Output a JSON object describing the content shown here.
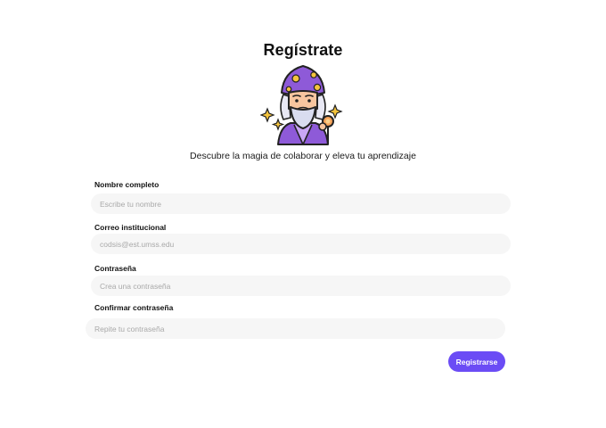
{
  "header": {
    "title": "Regístrate",
    "subtitle": "Descubre la magia de colaborar y eleva tu aprendizaje"
  },
  "mascot": {
    "icon": "wizard-icon"
  },
  "form": {
    "fields": [
      {
        "label": "Nombre completo",
        "placeholder": "Escribe tu nombre",
        "value": ""
      },
      {
        "label": "Correo institucional",
        "placeholder": "codsis@est.umss.edu",
        "value": ""
      },
      {
        "label": "Contraseña",
        "placeholder": "Crea una contraseña",
        "value": ""
      },
      {
        "label": "Confirmar contraseña",
        "placeholder": "Repite tu contraseña",
        "value": ""
      }
    ],
    "submit_label": "Registrarse"
  },
  "colors": {
    "accent": "#6b4cf5",
    "input_bg": "#f6f6f6"
  }
}
